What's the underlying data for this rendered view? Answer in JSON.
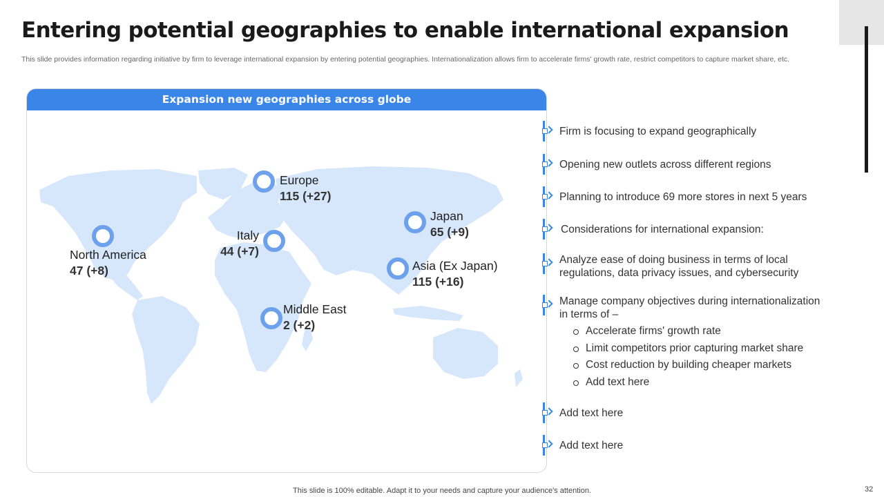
{
  "slide": {
    "title": "Entering potential geographies to enable international expansion",
    "subtitle": "This slide provides information regarding initiative by firm to leverage international expansion by entering potential geographies. Internationalization allows firm to accelerate firms' growth rate, restrict competitors to capture market share, etc.",
    "footer": "This slide is 100% editable. Adapt it to your needs and capture your audience's attention.",
    "page_number": "32"
  },
  "map": {
    "header": "Expansion new geographies across globe",
    "regions": [
      {
        "name": "Europe",
        "count": "115 (+27)"
      },
      {
        "name": "Japan",
        "count": "65 (+9)"
      },
      {
        "name": "Italy",
        "count": "44 (+7)"
      },
      {
        "name": "North America",
        "count": "47 (+8)"
      },
      {
        "name": "Asia (Ex Japan)",
        "count": "115 (+16)"
      },
      {
        "name": "Middle East",
        "count": "2 (+2)"
      }
    ]
  },
  "bullets": [
    {
      "text": "Firm is focusing to expand geographically"
    },
    {
      "text": "Opening new outlets across different regions"
    },
    {
      "text": "Planning to introduce 69 more stores in next 5 years"
    },
    {
      "text": "Considerations for international expansion:"
    },
    {
      "line1": "Analyze ease of doing business in terms of local",
      "line2": "regulations, data privacy issues, and cybersecurity"
    },
    {
      "line1": "Manage company objectives during internationalization",
      "line2": "in terms of –"
    },
    {
      "text": "Add text here"
    },
    {
      "text": "Add text here"
    }
  ],
  "sub_bullets": [
    "Accelerate firms' growth rate",
    "Limit competitors prior capturing market share",
    "Cost reduction by building cheaper markets",
    "Add text here"
  ],
  "colors": {
    "accent": "#3a86e8",
    "map_land": "#d6e6fb",
    "pin": "#6da1ec",
    "title": "#1a1a1a"
  }
}
